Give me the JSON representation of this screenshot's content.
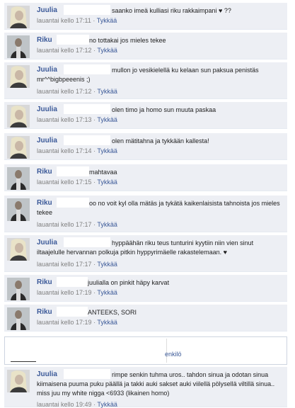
{
  "comments": [
    {
      "author": "Juulia",
      "text": "saanko imeä kulliasi riku rakkaimpani ♥ ??",
      "date": "lauantai kello 17:11",
      "separator": "·",
      "like": "Tykkää"
    },
    {
      "author": "Riku",
      "text": "no tottakai jos mieles tekee",
      "date": "lauantai kello 17:12",
      "separator": "·",
      "like": "Tykkää"
    },
    {
      "author": "Juulia",
      "text": "mullon jo vesikielellä ku kelaan sun paksua penistäs mr^^bigbpeeenis ;)",
      "date": "lauantai kello 17:12",
      "separator": "·",
      "like": "Tykkää"
    },
    {
      "author": "Juulia",
      "text": "olen timo ja homo sun muuta paskaa",
      "date": "lauantai kello 17:13",
      "separator": "·",
      "like": "Tykkää"
    },
    {
      "author": "Juulia",
      "text": "olen mätitahna ja tykkään kallesta!",
      "date": "lauantai kello 17:14",
      "separator": "·",
      "like": "Tykkää"
    },
    {
      "author": "Riku",
      "text": "mahtavaa",
      "date": "lauantai kello 17:15",
      "separator": "·",
      "like": "Tykkää"
    },
    {
      "author": "Riku",
      "text": "oo no voit kyl olla mätäs ja tykätä kaikenlaisista tahnoista jos mieles tekee",
      "date": "lauantai kello 17:17",
      "separator": "·",
      "like": "Tykkää"
    },
    {
      "author": "Juulia",
      "text": "hyppäähän riku teus tunturini kyytiin niin vien sinut iltaajelulle hervannan polkuja pitkin hyppyrimäelle rakastelemaan. ♥",
      "date": "lauantai kello 17:17",
      "separator": "·",
      "like": "Tykkää"
    },
    {
      "author": "Riku",
      "text": "juulialla on pinkit häpy karvat",
      "date": "lauantai kello 17:19",
      "separator": "·",
      "like": "Tykkää"
    },
    {
      "author": "Riku",
      "text": "ANTEEKS, SORI",
      "date": "lauantai kello 17:19",
      "separator": "·",
      "like": "Tykkää"
    },
    {
      "author": "Juulia",
      "text": "rimpe senkin tuhma uros.. tahdon sinua ja odotan sinua kiimaisena puuma puku päällä ja takki auki sakset auki viilellä pölysellä viltillä sinua.. miss juu my white nigga <6933 (likainen homo)",
      "date": "lauantai kello 19:49",
      "separator": "·",
      "like": "Tykkää"
    }
  ],
  "comment_box": {
    "tail_text": "enkilö"
  },
  "colors": {
    "accent": "#3b5998",
    "row_bg": "#edeff4",
    "meta": "#808080"
  }
}
